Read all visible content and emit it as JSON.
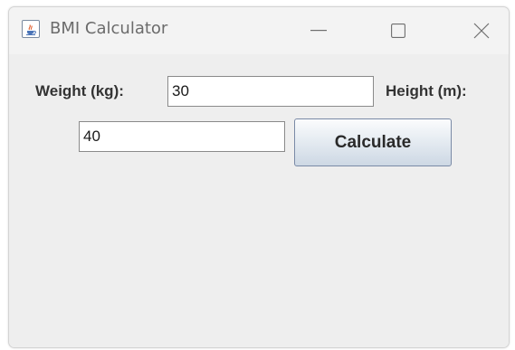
{
  "window": {
    "title": "BMI Calculator",
    "icon": "java-cup-icon"
  },
  "controls": {
    "minimize_icon": "minimize-icon",
    "maximize_icon": "maximize-icon",
    "close_icon": "close-icon"
  },
  "form": {
    "weight_label": "Weight (kg):",
    "weight_value": "30",
    "height_label": "Height (m):",
    "height_value": "40",
    "calculate_label": "Calculate"
  },
  "colors": {
    "window_bg": "#eeeeee",
    "titlebar_bg": "#f3f3f3",
    "button_border": "#7a8aa6"
  }
}
